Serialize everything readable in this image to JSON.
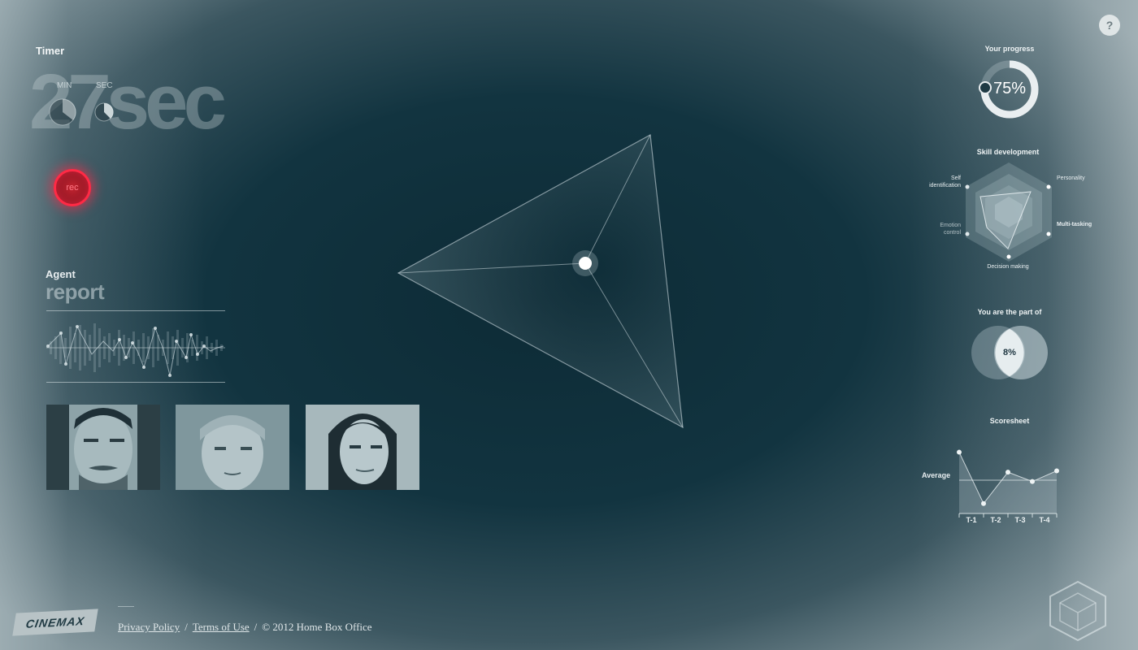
{
  "timer": {
    "label": "Timer",
    "value": "27sec",
    "min_label": "MIN",
    "sec_label": "SEC"
  },
  "rec": {
    "label": "rec",
    "color": "#ff2a45"
  },
  "agent_report": {
    "line1": "Agent",
    "line2": "report"
  },
  "help": {
    "label": "?"
  },
  "progress": {
    "title": "Your progress",
    "value": "75%",
    "fraction": 0.75
  },
  "skills": {
    "title": "Skill development",
    "axes": [
      "Self identification",
      "Personality",
      "Multi-tasking",
      "Decision making",
      "Emotion control"
    ]
  },
  "part": {
    "title": "You are the part of",
    "value": "8%"
  },
  "scoresheet": {
    "title": "Scoresheet",
    "average_label": "Average",
    "chart_data": {
      "type": "line",
      "categories": [
        "T-1",
        "T-2",
        "T-3",
        "T-4"
      ],
      "values": [
        0.92,
        0.15,
        0.62,
        0.48,
        0.64
      ],
      "average": 0.5
    }
  },
  "footer": {
    "privacy": "Privacy Policy",
    "terms": "Terms of Use",
    "copyright": "© 2012 Home Box Office",
    "sep": "/"
  },
  "brand": {
    "logo": "CINEMAX"
  }
}
